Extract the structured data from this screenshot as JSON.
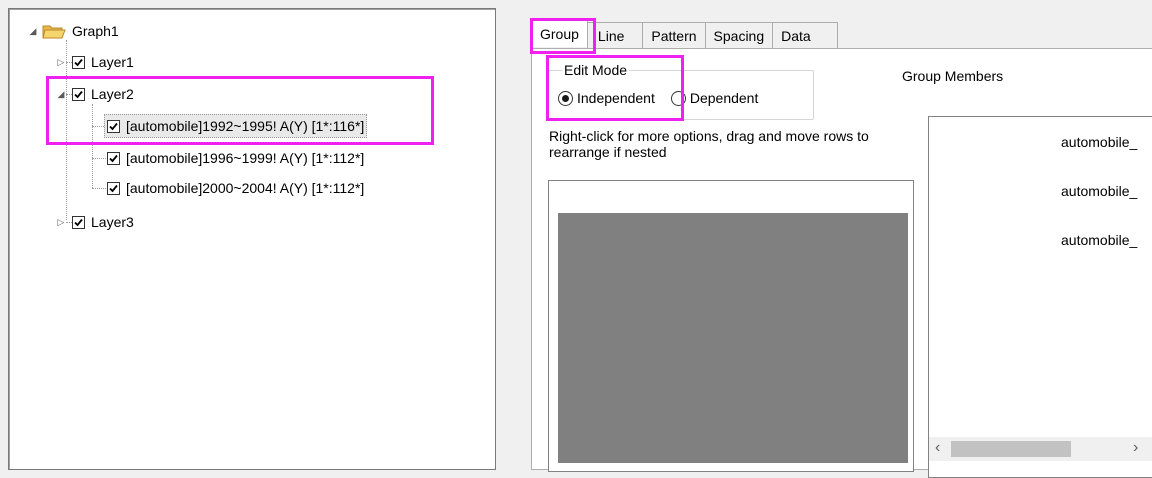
{
  "tree": {
    "root": {
      "label": "Graph1"
    },
    "layers": [
      {
        "label": "Layer1",
        "checked": true,
        "expanded": false
      },
      {
        "label": "Layer2",
        "checked": true,
        "expanded": true
      },
      {
        "label": "Layer3",
        "checked": true,
        "expanded": false
      }
    ],
    "plots": [
      {
        "label": "[automobile]1992~1995! A(Y) [1*:116*]",
        "checked": true,
        "selected": true
      },
      {
        "label": "[automobile]1996~1999! A(Y) [1*:112*]",
        "checked": true
      },
      {
        "label": "[automobile]2000~2004! A(Y) [1*:112*]",
        "checked": true
      }
    ]
  },
  "tabs": [
    "Group",
    "Line",
    "Pattern",
    "Spacing",
    "Data"
  ],
  "active_tab": "Group",
  "edit_mode": {
    "title": "Edit Mode",
    "options": [
      "Independent",
      "Dependent"
    ],
    "selected": "Independent"
  },
  "hint": "Right-click for more options, drag and move rows to  rearrange if nested",
  "group_members": {
    "title": "Group Members",
    "items": [
      "automobile_",
      "automobile_",
      "automobile_"
    ]
  },
  "colors": {
    "highlight": "#f021f0",
    "folder": "#f5c542",
    "gray_area": "#808080"
  }
}
